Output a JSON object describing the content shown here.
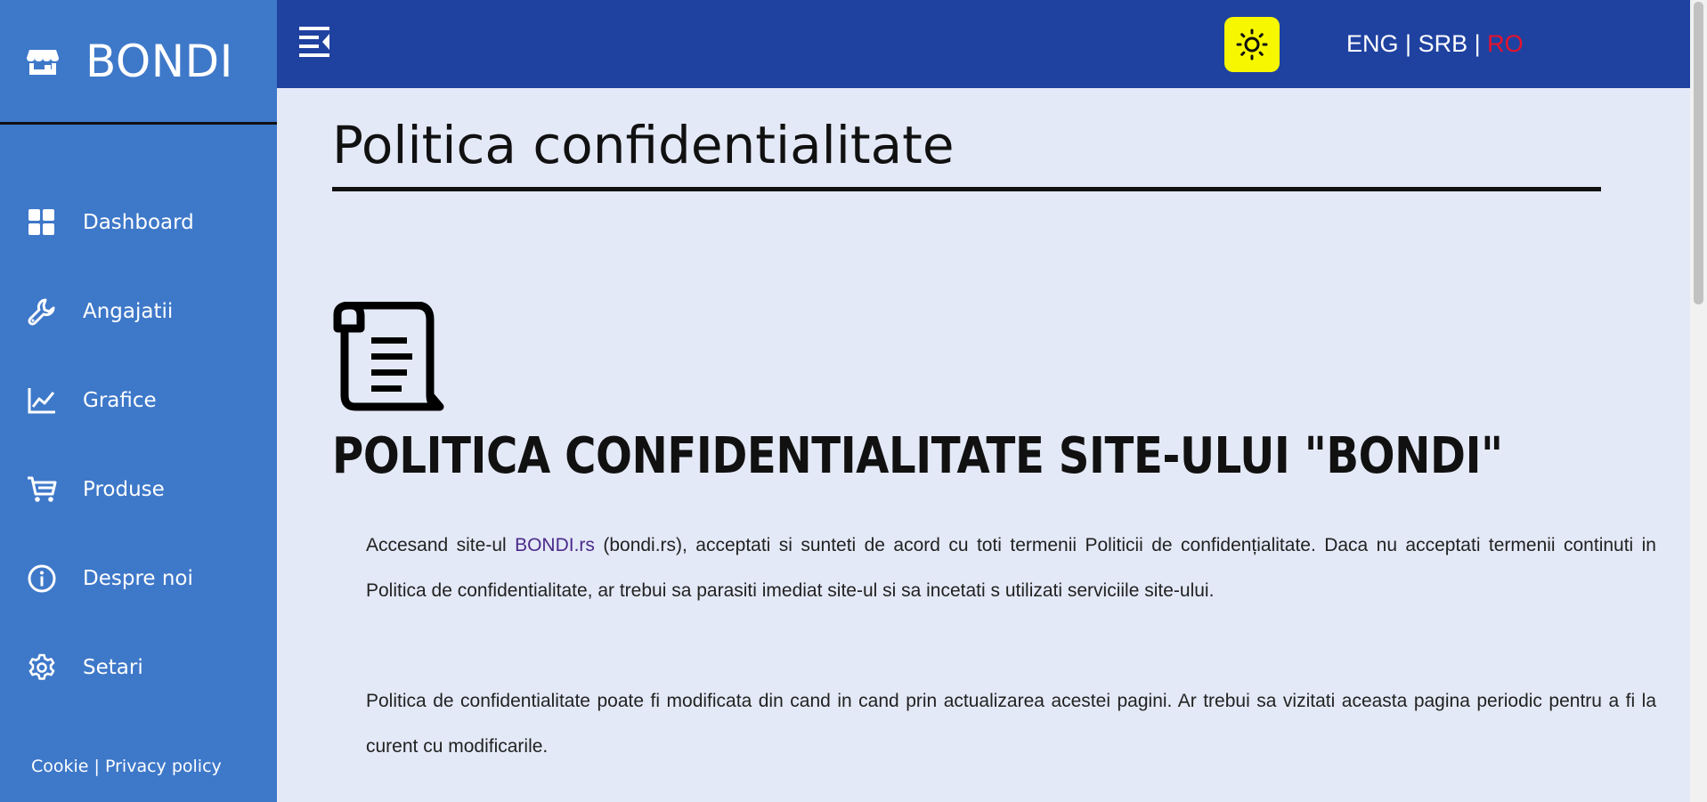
{
  "brand": {
    "name": "BONDI",
    "logo_icon": "store-icon"
  },
  "sidebar": {
    "items": [
      {
        "label": "Dashboard",
        "icon": "dashboard-icon"
      },
      {
        "label": "Angajatii",
        "icon": "wrench-icon"
      },
      {
        "label": "Grafice",
        "icon": "chart-line-icon"
      },
      {
        "label": "Produse",
        "icon": "cart-icon"
      },
      {
        "label": "Despre noi",
        "icon": "info-icon"
      },
      {
        "label": "Setari",
        "icon": "gear-icon"
      }
    ],
    "footer": {
      "cookie": "Cookie",
      "separator": "|",
      "privacy": "Privacy policy"
    }
  },
  "header": {
    "languages": [
      {
        "label": "ENG",
        "active": false
      },
      {
        "label": "SRB",
        "active": false
      },
      {
        "label": "RO",
        "active": true
      }
    ],
    "separator": "|"
  },
  "main": {
    "title": "Politica confidentialitate",
    "heading": "POLITICA CONFIDENTIALITATE SITE-ULUI \"BONDI\"",
    "para1": {
      "before": "Accesand site-ul ",
      "link": "BONDI.rs",
      "after": " (bondi.rs), acceptati si sunteti de acord cu toti termenii Politicii de confidențialitate. Daca nu acceptati termenii continuti in Politica de confidentialitate, ar trebui sa parasiti imediat site-ul si sa incetati s utilizati serviciile site-ului."
    },
    "para2": "Politica de confidentialitate poate fi modificata din cand in cand prin actualizarea acestei pagini. Ar trebui sa vizitati aceasta pagina periodic pentru a fi la curent cu modificarile."
  },
  "colors": {
    "sidebar": "#3e78c9",
    "header": "#1f42a0",
    "background": "#e4e9f7",
    "theme_button": "#f7f700",
    "active_language": "#e8122c",
    "link": "#4b2a8a"
  }
}
